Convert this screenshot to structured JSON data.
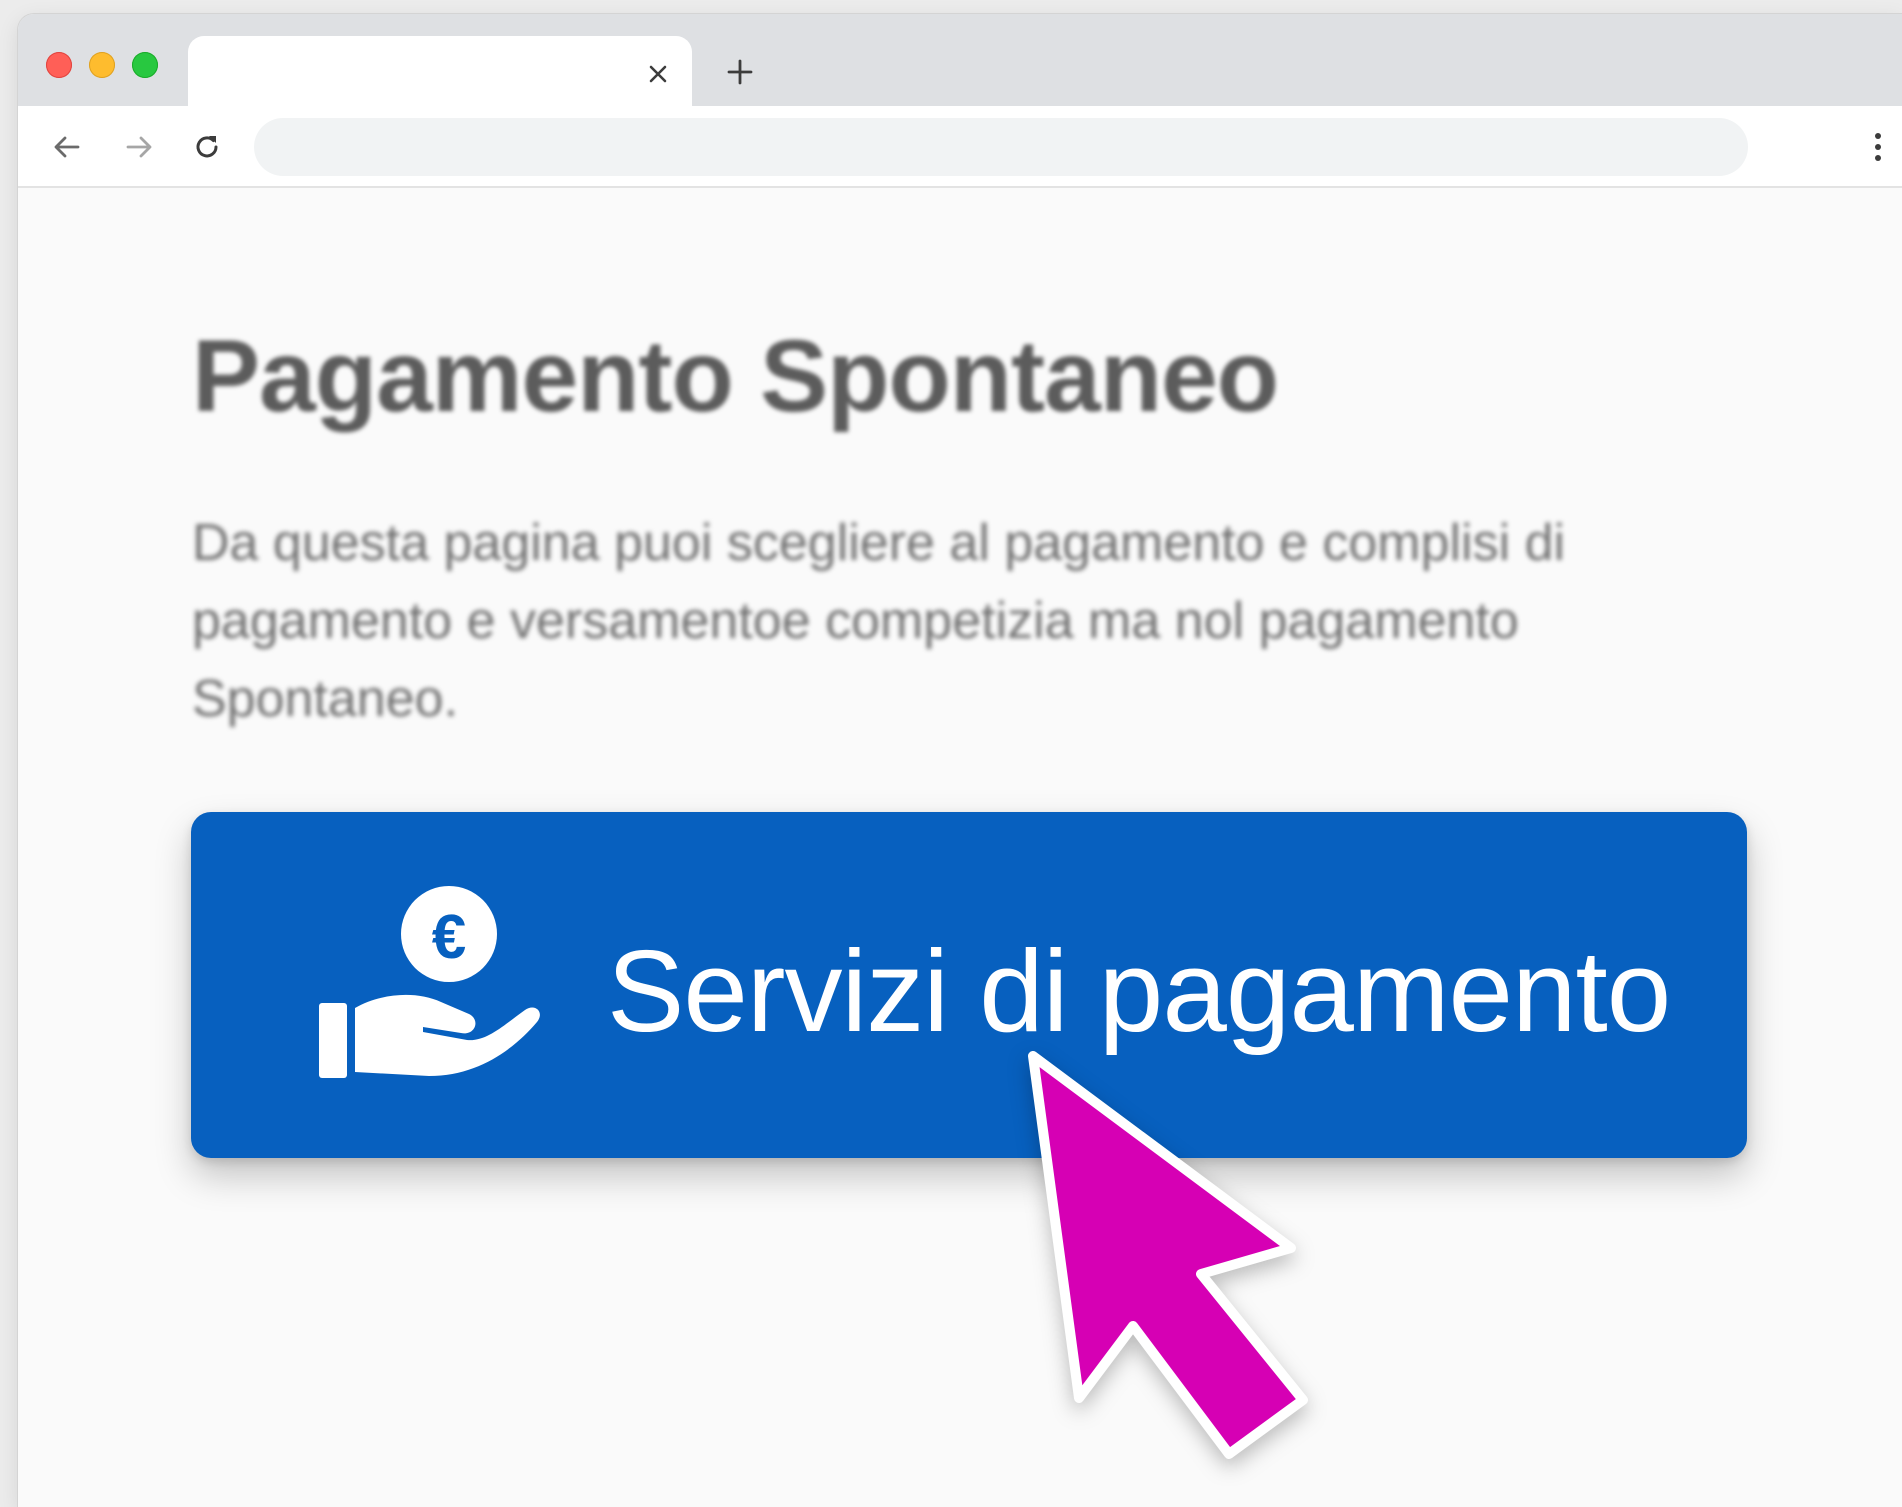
{
  "browser": {
    "tab": {
      "title": "",
      "close_icon": "close-icon"
    },
    "new_tab_icon": "plus-icon",
    "toolbar": {
      "back_icon": "arrow-left-icon",
      "forward_icon": "arrow-right-icon",
      "reload_icon": "reload-icon",
      "address_value": "",
      "menu_icon": "kebab-menu-icon"
    }
  },
  "page": {
    "title": "Pagamento Spontaneo",
    "description": "Da questa pagina puoi scegliere al pagamento e complisi di pagamento e versamentoe competizia ma nol pagamento Spontaneo.",
    "payment_button": {
      "label": "Servizi di pagamento",
      "icon": "euro-hand-icon",
      "background_color": "#0760bf"
    },
    "cursor": {
      "icon": "mouse-pointer-icon",
      "color": "#d600b4"
    }
  },
  "colors": {
    "traffic_red": "#ff5f57",
    "traffic_yellow": "#febc2e",
    "traffic_green": "#28c840"
  }
}
